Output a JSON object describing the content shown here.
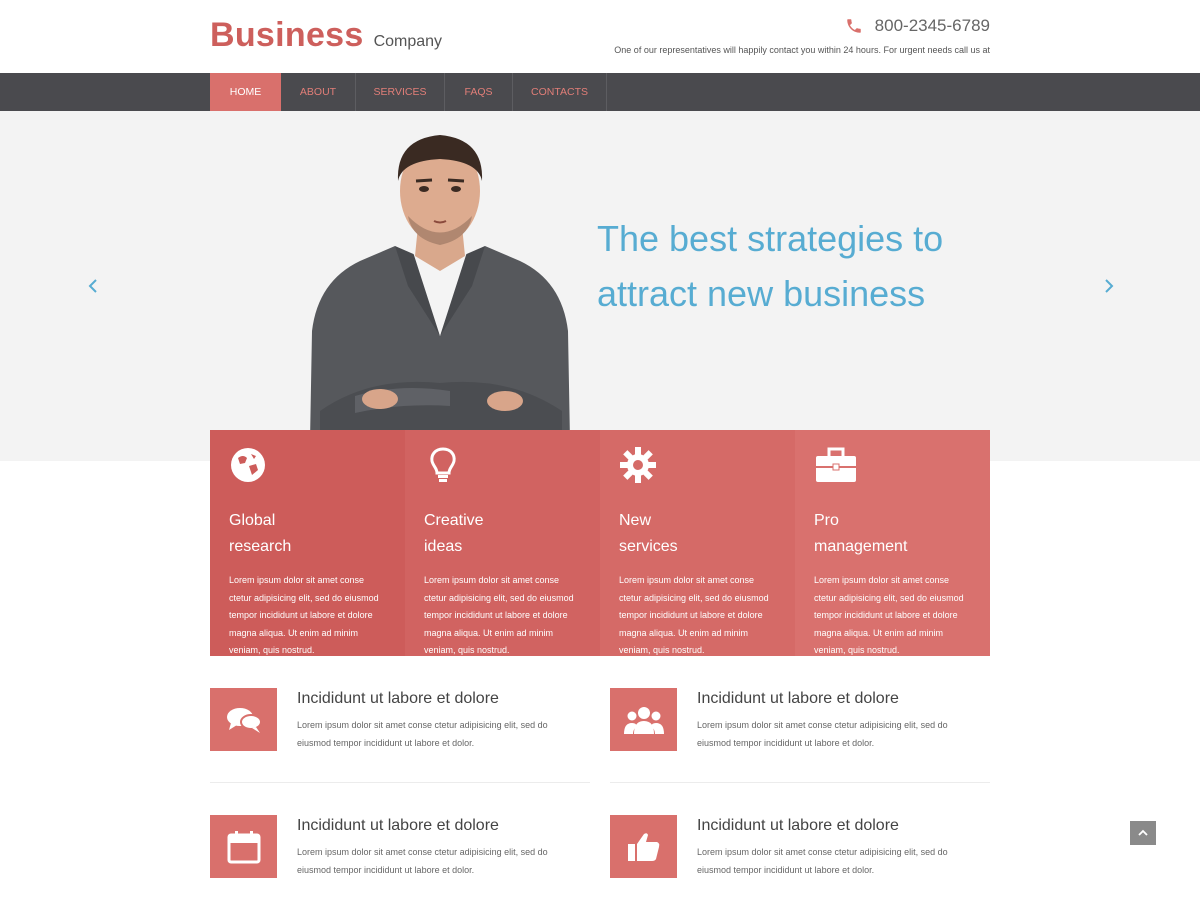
{
  "header": {
    "logo_main": "Business",
    "logo_sub": "Company",
    "phone": "800-2345-6789",
    "contact_note": "One of our representatives will happily contact you within 24 hours. For urgent needs call us at"
  },
  "nav": {
    "items": [
      {
        "label": "HOME",
        "active": true
      },
      {
        "label": "ABOUT",
        "active": false
      },
      {
        "label": "SERVICES",
        "active": false
      },
      {
        "label": "FAQS",
        "active": false
      },
      {
        "label": "CONTACTS",
        "active": false
      }
    ]
  },
  "hero": {
    "title_line1": "The best strategies to",
    "title_line2": "attract new business"
  },
  "features": [
    {
      "icon": "globe-icon",
      "title": "Global\nresearch",
      "text": "Lorem ipsum dolor sit amet conse ctetur adipisicing elit, sed do eiusmod tempor incididunt ut labore et dolore magna aliqua. Ut enim ad minim veniam, quis nostrud.",
      "color": "#cd5c5a"
    },
    {
      "icon": "lightbulb-icon",
      "title": "Creative\nideas",
      "text": "Lorem ipsum dolor sit amet conse ctetur adipisicing elit, sed do eiusmod tempor incididunt ut labore et dolore magna aliqua. Ut enim ad minim veniam, quis nostrud.",
      "color": "#d16361"
    },
    {
      "icon": "gear-icon",
      "title": "New\nservices",
      "text": "Lorem ipsum dolor sit amet conse ctetur adipisicing elit, sed do eiusmod tempor incididunt ut labore et dolore magna aliqua. Ut enim ad minim veniam, quis nostrud.",
      "color": "#d56a67"
    },
    {
      "icon": "briefcase-icon",
      "title": "Pro\nmanagement",
      "text": "Lorem ipsum dolor sit amet conse ctetur adipisicing elit, sed do eiusmod tempor incididunt ut labore et dolore magna aliqua. Ut enim ad minim veniam, quis nostrud.",
      "color": "#d9716e"
    }
  ],
  "info_blocks": [
    {
      "icon": "chat-icon",
      "title": "Incididunt ut labore et dolore",
      "text": "Lorem ipsum dolor sit amet conse ctetur adipisicing elit, sed do eiusmod tempor incididunt ut labore et dolor."
    },
    {
      "icon": "users-icon",
      "title": "Incididunt ut labore et dolore",
      "text": "Lorem ipsum dolor sit amet conse ctetur adipisicing elit, sed do eiusmod tempor incididunt ut labore et dolor."
    },
    {
      "icon": "calendar-icon",
      "title": "Incididunt ut labore et dolore",
      "text": "Lorem ipsum dolor sit amet conse ctetur adipisicing elit, sed do eiusmod tempor incididunt ut labore et dolor."
    },
    {
      "icon": "thumbs-up-icon",
      "title": "Incididunt ut labore et dolore",
      "text": "Lorem ipsum dolor sit amet conse ctetur adipisicing elit, sed do eiusmod tempor incididunt ut labore et dolor."
    }
  ],
  "colors": {
    "accent": "#d9706c",
    "nav_bg": "#4a4a4e",
    "hero_text": "#57acd2",
    "hero_bg": "#f3f3f3"
  }
}
